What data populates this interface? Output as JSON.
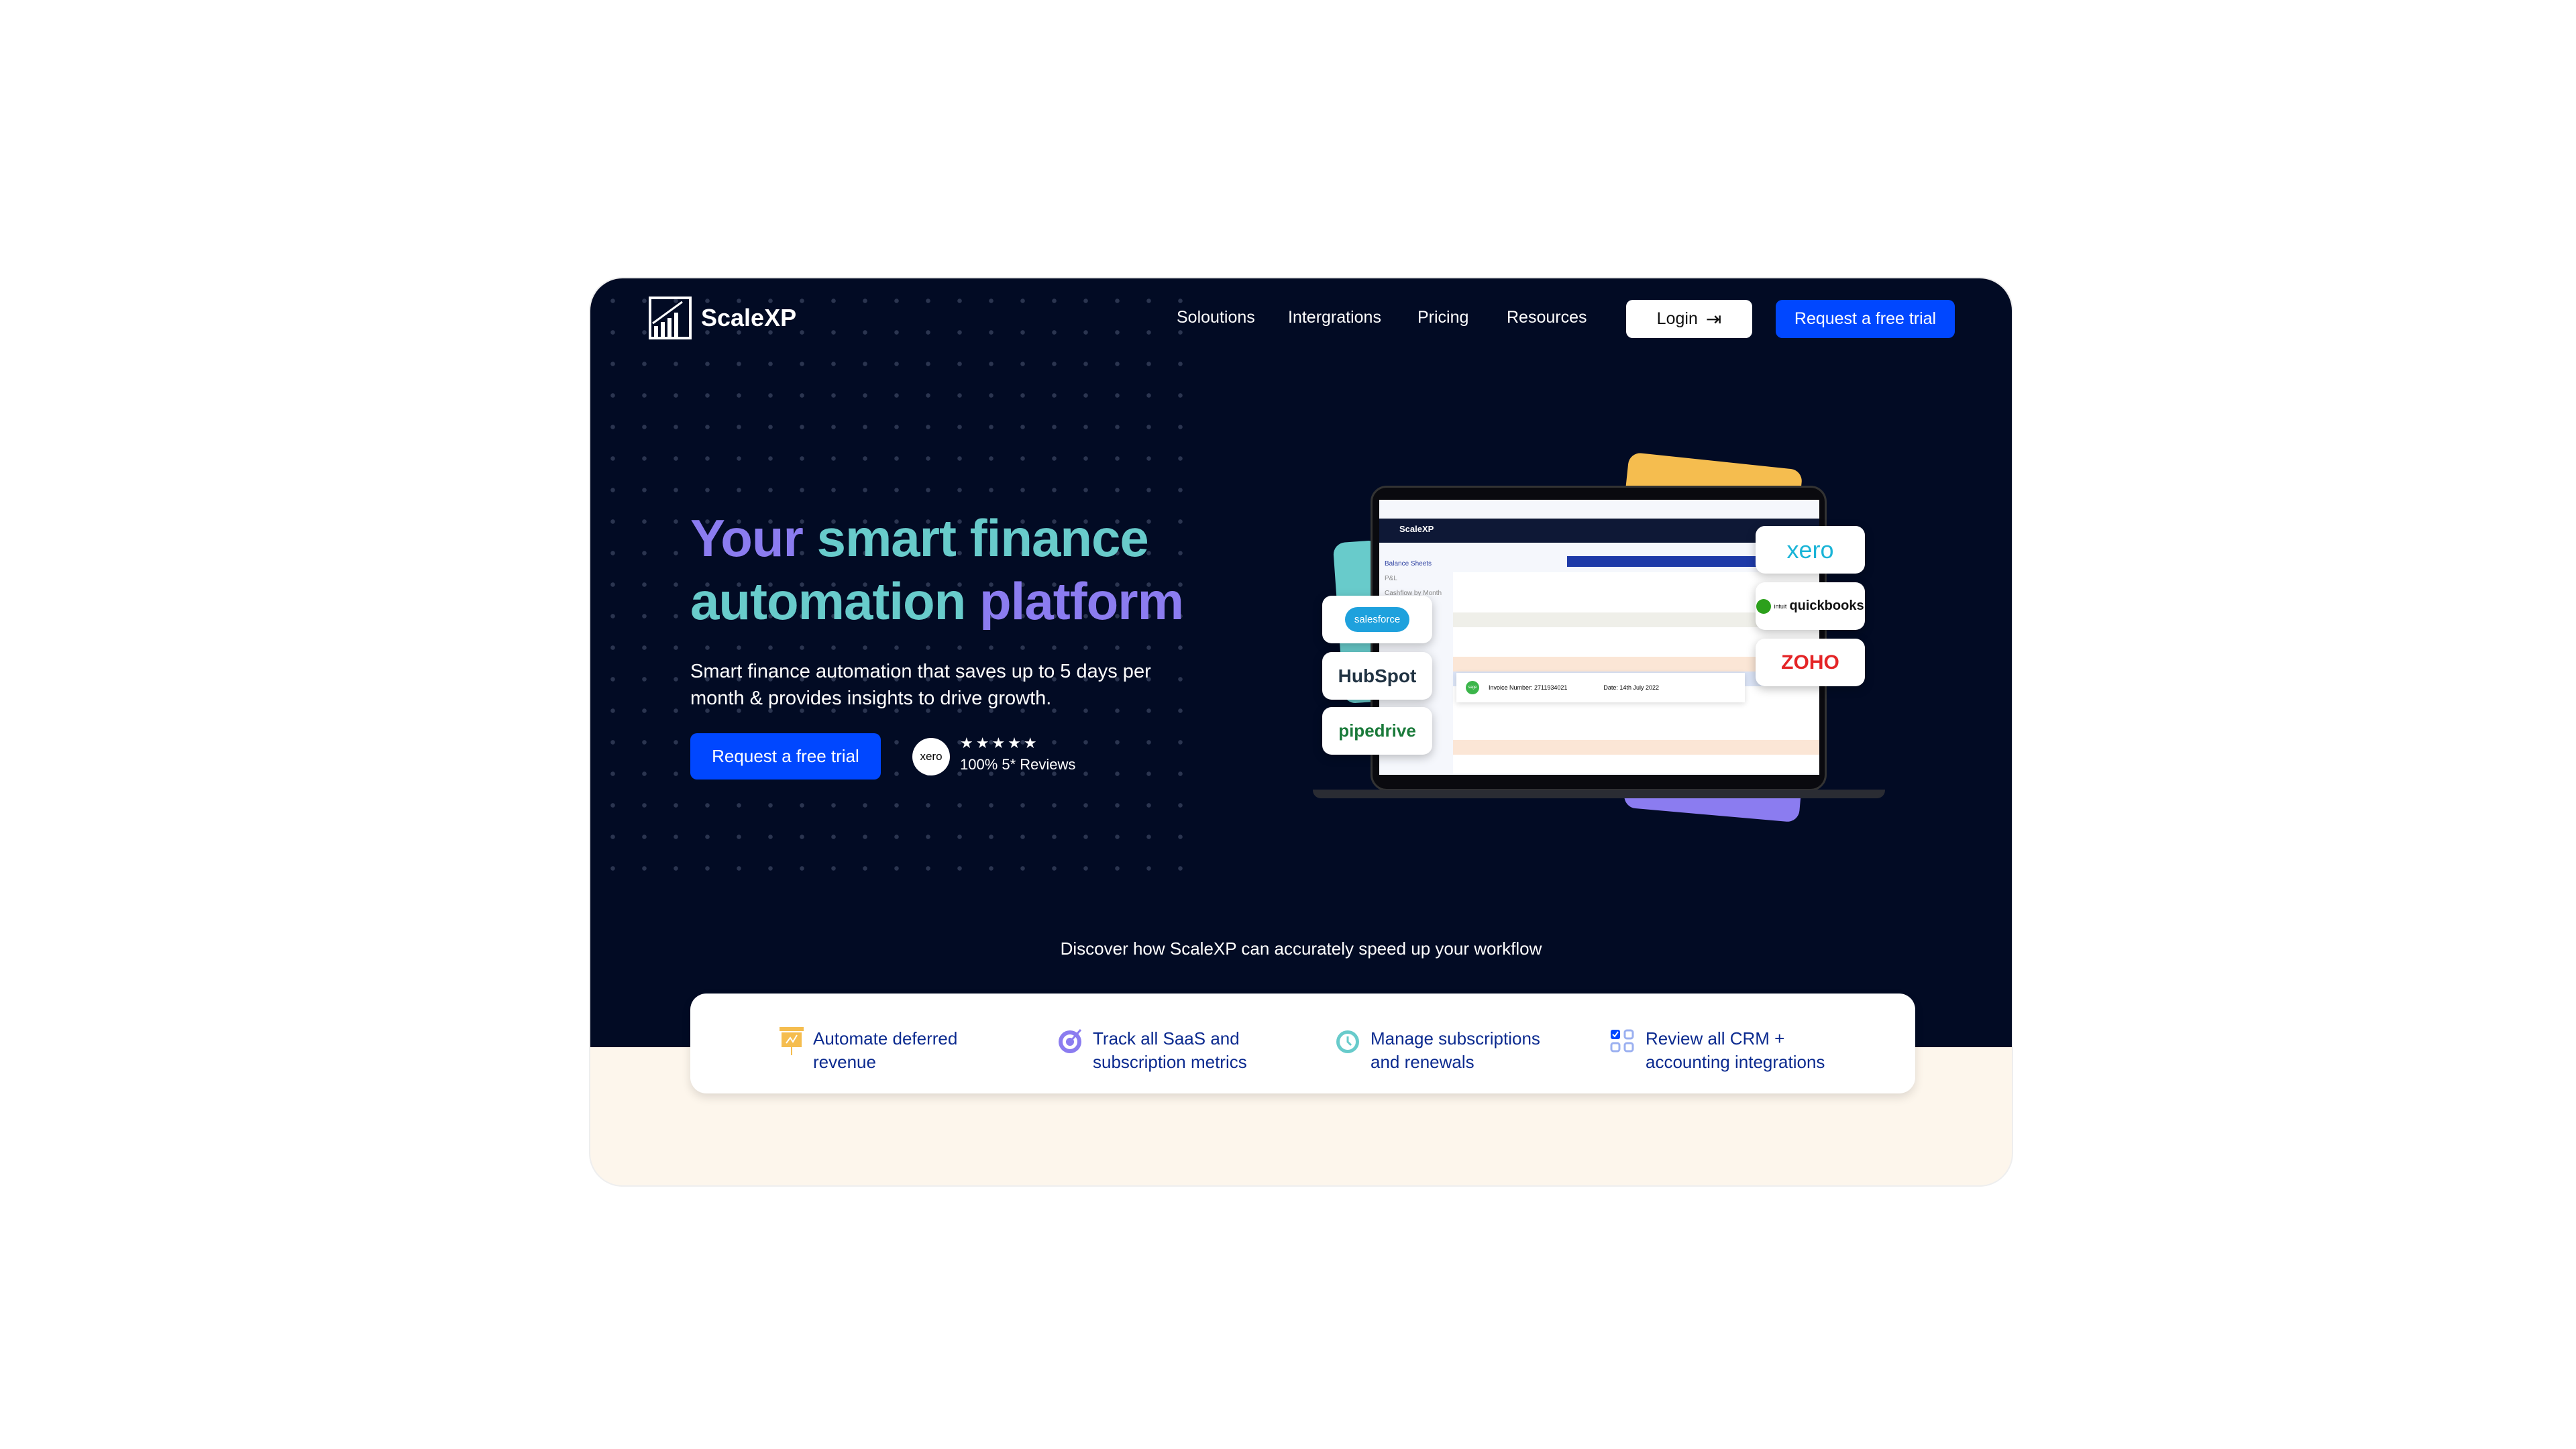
{
  "brand": {
    "name": "ScaleXP"
  },
  "nav": {
    "items": [
      "Soloutions",
      "Intergrations",
      "Pricing",
      "Resources"
    ],
    "login": "Login",
    "cta": "Request a free trial"
  },
  "hero": {
    "title_part1": "Your",
    "title_part2": "smart finance",
    "title_part3": "automation",
    "title_part4": "platform",
    "subtitle": "Smart finance automation that saves up to 5 days per month & provides insights to drive growth.",
    "cta": "Request a free trial",
    "review_logo": "xero",
    "stars": "★★★★★",
    "reviews": "100% 5* Reviews"
  },
  "illustration": {
    "app_name": "ScaleXP",
    "sidebar": [
      "Balance Sheets",
      "P&L",
      "Cashflow by Month"
    ],
    "invoice_number": "Invoice Number: 2711934021",
    "invoice_date": "Date: 14th July 2022",
    "invoice_badge": "sage",
    "left_logos": [
      "salesforce",
      "HubSpot",
      "pipedrive"
    ],
    "right_logos": [
      "xero",
      "quickbooks",
      "ZOHO"
    ],
    "qb_prefix": "intuit"
  },
  "discover": "Discover how ScaleXP can accurately speed up your workflow",
  "features": [
    {
      "line1": "Automate deferred",
      "line2": "revenue",
      "icon": "presentation-chart-icon",
      "color": "#f5bd4f"
    },
    {
      "line1": "Track all SaaS and",
      "line2": "subscription metrics",
      "icon": "target-icon",
      "color": "#8b7cf0"
    },
    {
      "line1": "Manage subscriptions",
      "line2": "and renewals",
      "icon": "clock-icon",
      "color": "#68cbcb"
    },
    {
      "line1": "Review all CRM +",
      "line2": "accounting integrations",
      "icon": "grid-check-icon",
      "color": "#0047ff"
    }
  ],
  "colors": {
    "bg_dark": "#020b24",
    "accent_blue": "#0047ff",
    "purple": "#8b7cf0",
    "teal": "#68cbcb",
    "cream": "#fdf6ec"
  }
}
